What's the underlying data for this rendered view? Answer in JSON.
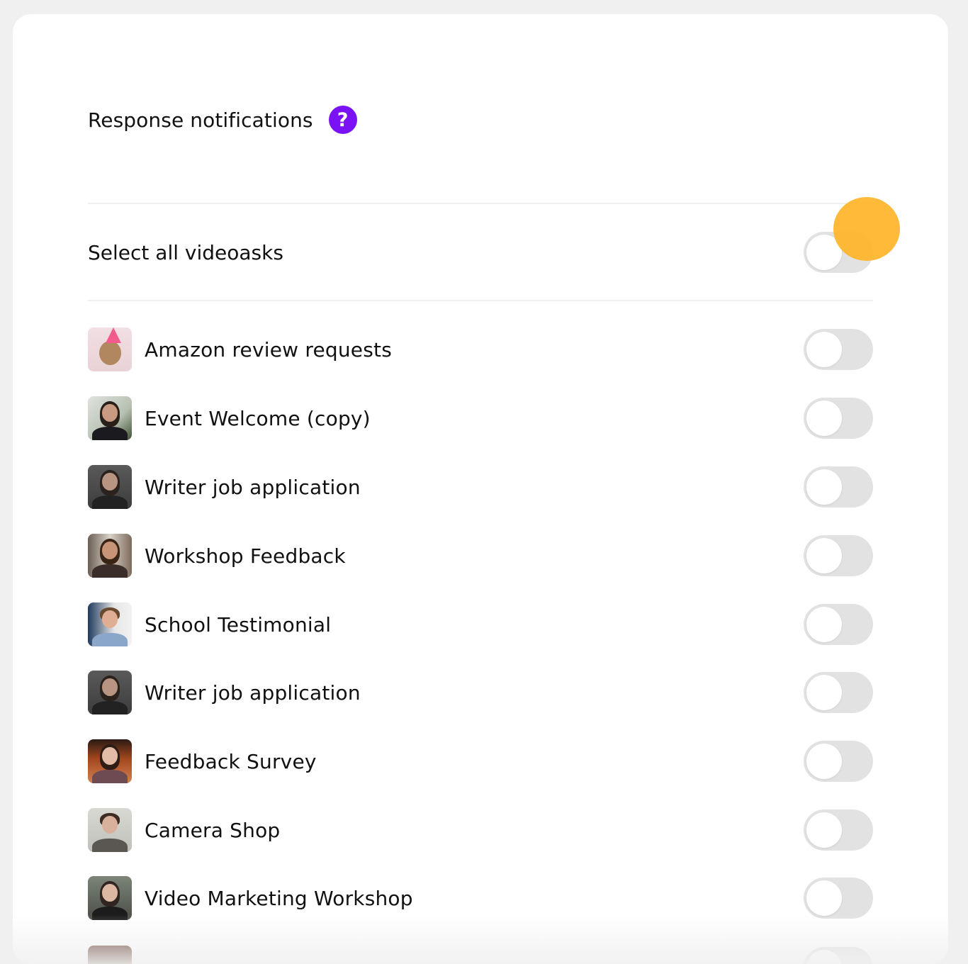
{
  "header": {
    "title": "Response notifications",
    "help_icon": "question-mark-icon",
    "help_symbol": "?",
    "help_color": "#7a12f5"
  },
  "select_all": {
    "label": "Select all videoasks",
    "enabled": false
  },
  "videoasks": [
    {
      "label": "Amazon review requests",
      "enabled": false
    },
    {
      "label": "Event Welcome (copy)",
      "enabled": false
    },
    {
      "label": "Writer job application",
      "enabled": false
    },
    {
      "label": "Workshop Feedback",
      "enabled": false
    },
    {
      "label": "School Testimonial",
      "enabled": false
    },
    {
      "label": "Writer job application",
      "enabled": false
    },
    {
      "label": "Feedback Survey",
      "enabled": false
    },
    {
      "label": "Camera Shop",
      "enabled": false
    },
    {
      "label": "Video Marketing Workshop",
      "enabled": false
    },
    {
      "label": "",
      "enabled": false
    }
  ],
  "colors": {
    "toggle_off": "#e2e2e2",
    "cursor_highlight": "#ffb428"
  }
}
